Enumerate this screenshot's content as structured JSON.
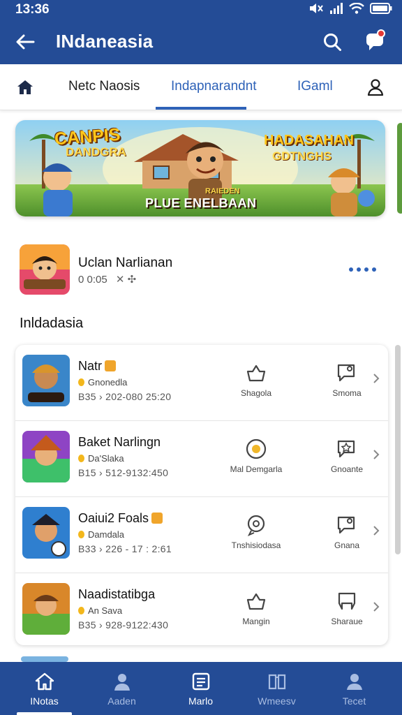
{
  "status_bar": {
    "time": "13:36",
    "icons": [
      "mute-icon",
      "signal-icon",
      "wifi-icon",
      "battery-icon"
    ]
  },
  "app_bar": {
    "title": "INdaneasia",
    "back_icon": "arrow-left-icon",
    "search_icon": "search-icon",
    "notification_icon": "chat-bubble-icon"
  },
  "tabs": {
    "home_icon": "home-icon",
    "items": [
      {
        "label": "Netc Naosis"
      },
      {
        "label": "Indapnarandnt"
      },
      {
        "label": "IGaml"
      }
    ],
    "active_index": 1,
    "profile_icon": "user-icon"
  },
  "banner": {
    "left_title": "CANPIS",
    "left_subtitle": "DANDGRA",
    "right_title": "HADASAHAN",
    "right_subtitle": "GDTNGHS",
    "small_caption": "RAIEDEN",
    "bottom_caption": "PLUE ENELBAAN"
  },
  "featured": {
    "name": "Uclan Narlianan",
    "meta": "0 0:05",
    "more_icon": "more-dots-icon"
  },
  "section": {
    "title": "Inldadasia"
  },
  "list": [
    {
      "name": "Natr",
      "subtitle": "Gnonedla",
      "meta": "B35 › 202-080 25:20",
      "action1": {
        "label": "Shagola",
        "icon": "crown-icon"
      },
      "action2": {
        "label": "Smoma",
        "icon": "share-card-icon"
      }
    },
    {
      "name": "Baket Narlingn",
      "subtitle": "Da'Slaka",
      "meta": "B15 › 512-9132:450",
      "action1": {
        "label": "Mal Demgarla",
        "icon": "target-icon"
      },
      "action2": {
        "label": "Gnoante",
        "icon": "star-card-icon"
      }
    },
    {
      "name": "Oaiui2 Foals",
      "subtitle": "Damdala",
      "meta": "B33 › 226 - 17 : 2:61",
      "action1": {
        "label": "Tnshisiodasa",
        "icon": "chat-circle-icon"
      },
      "action2": {
        "label": "Gnana",
        "icon": "share-card-icon"
      }
    },
    {
      "name": "Naadistatibga",
      "subtitle": "An Sava",
      "meta": "B35 › 928-9122:430",
      "action1": {
        "label": "Mangin",
        "icon": "crown-icon"
      },
      "action2": {
        "label": "Sharaue",
        "icon": "frame-icon"
      }
    }
  ],
  "bottom_nav": [
    {
      "label": "INotas",
      "icon": "home-icon",
      "active": true
    },
    {
      "label": "Aaden",
      "icon": "person-icon",
      "active": false
    },
    {
      "label": "Marlo",
      "icon": "list-card-icon",
      "active": false
    },
    {
      "label": "Wmeesv",
      "icon": "book-icon",
      "active": false
    },
    {
      "label": "Tecet",
      "icon": "profile-icon",
      "active": false
    }
  ],
  "colors": {
    "primary": "#244c96",
    "accent": "#2e62b8",
    "notification_dot": "#e53935"
  }
}
